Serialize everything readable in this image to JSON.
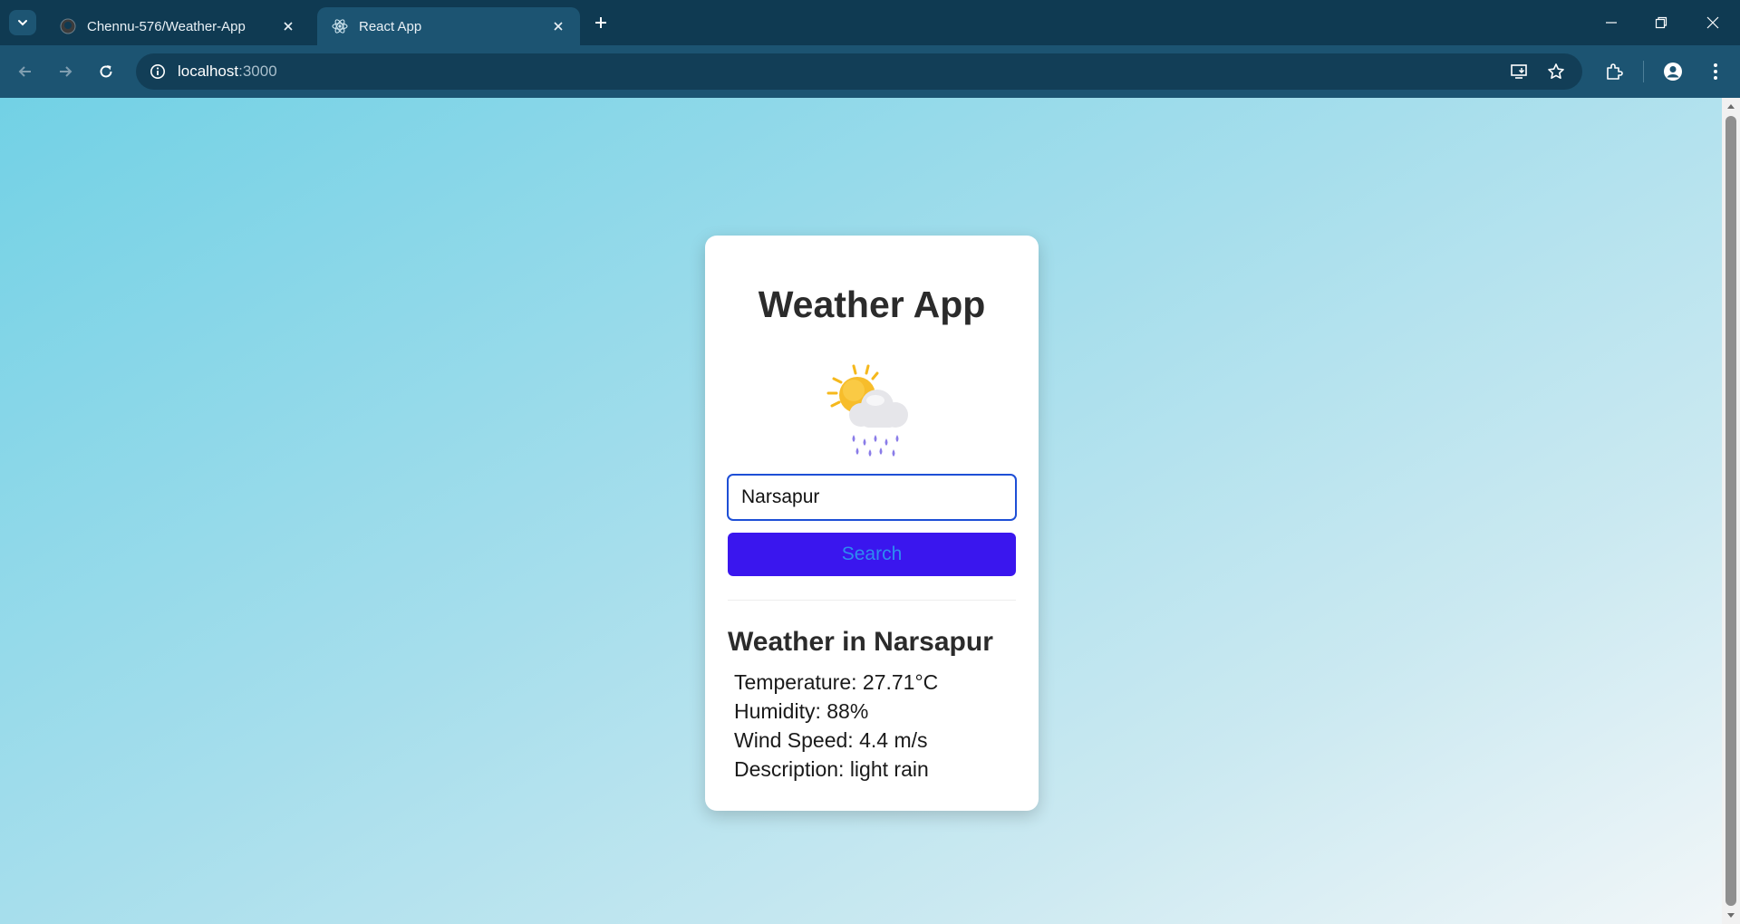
{
  "browser": {
    "tabs": [
      {
        "title": "Chennu-576/Weather-App",
        "active": false,
        "favicon": "github-icon"
      },
      {
        "title": "React App",
        "active": true,
        "favicon": "react-icon"
      }
    ],
    "address": {
      "host": "localhost",
      "port": ":3000"
    }
  },
  "app": {
    "title": "Weather App",
    "icon": "sun-behind-rain-cloud-icon",
    "search": {
      "value": "Narsapur",
      "button_label": "Search"
    },
    "result": {
      "heading": "Weather in Narsapur",
      "temperature": "Temperature: 27.71°C",
      "humidity": "Humidity: 88%",
      "wind": "Wind Speed: 4.4 m/s",
      "description": "Description: light rain"
    }
  },
  "colors": {
    "accent_button": "#3a16ee",
    "button_text": "#2d8cf0",
    "input_border": "#1e4fd6",
    "chrome_dark": "#0f3a52",
    "chrome_toolbar": "#1c5472"
  }
}
